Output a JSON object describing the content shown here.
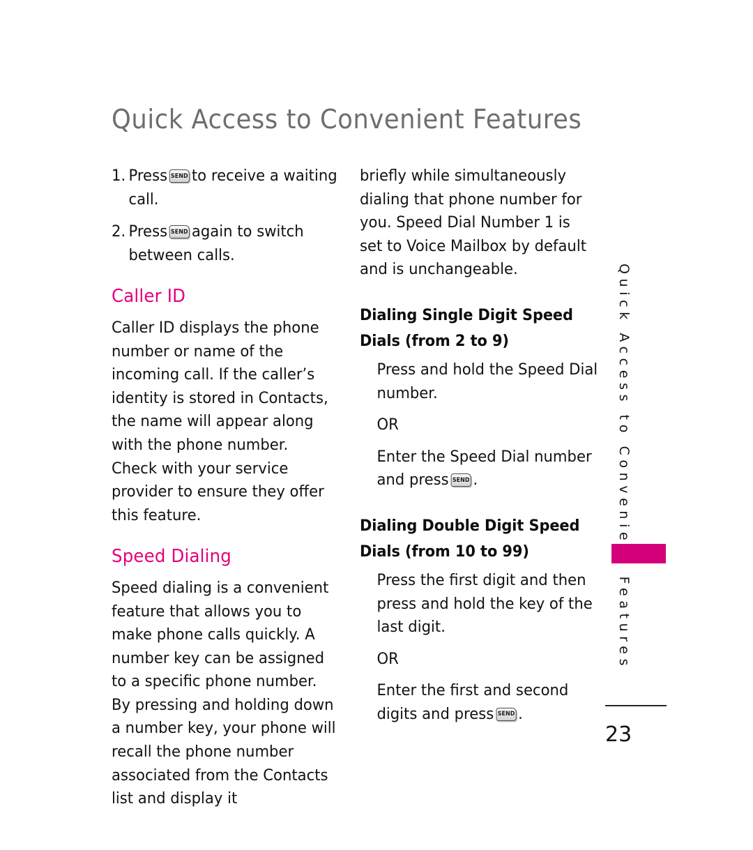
{
  "document": {
    "title": "Quick Access to Convenient Features",
    "page_number": "23",
    "side_tab_label": "Quick Access to Convenient Features",
    "accent_color": "#e3007d",
    "tab_color": "#d4007a",
    "title_color": "#6e6e6e"
  },
  "icons": {
    "send_key_label": "SEND"
  },
  "left_column": {
    "steps": [
      {
        "num": "1.",
        "before": "Press",
        "icon": "send-key-icon",
        "after": "to receive a waiting call."
      },
      {
        "num": "2.",
        "before": "Press",
        "icon": "send-key-icon",
        "after": "again to switch between calls."
      }
    ],
    "sections": [
      {
        "heading": "Caller ID",
        "body": "Caller ID displays the phone number or name of the incoming call. If the caller’s identity is stored in Contacts, the name will appear along with the phone number. Check with your service provider to ensure they offer this feature."
      },
      {
        "heading": "Speed Dialing",
        "body": "Speed dialing is a convenient feature that allows you to make phone calls quickly. A number key can be assigned to a specific phone number.  By pressing and holding down a number key, your phone will recall the phone number associated from the Contacts list and display it"
      }
    ]
  },
  "right_column": {
    "continuation": "briefly while simultaneously dialing that phone number for you.  Speed Dial Number 1 is set to Voice Mailbox by default and is unchangeable.",
    "subsections": [
      {
        "heading": "Dialing Single Digit Speed Dials (from 2 to 9)",
        "step_one": "Press and hold the Speed Dial number.",
        "or_label": "OR",
        "step_two_before": "Enter the Speed Dial number and press",
        "step_two_icon": "send-key-icon",
        "step_two_after": "."
      },
      {
        "heading": "Dialing Double Digit Speed Dials (from 10 to 99)",
        "step_one": "Press the first digit and then press and hold the key of the last digit.",
        "or_label": "OR",
        "step_two_before": "Enter the first and second digits and press",
        "step_two_icon": "send-key-icon",
        "step_two_after": "."
      }
    ]
  }
}
